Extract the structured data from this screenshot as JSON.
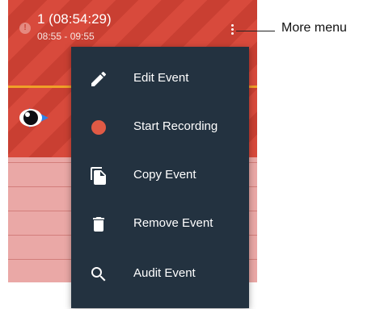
{
  "event": {
    "title": "1 (08:54:29)",
    "time_range": "08:55 - 09:55",
    "alert_icon": "alert-circle-icon",
    "more_icon": "kebab-vertical-icon",
    "track_icon": "eye-play-icon"
  },
  "menu": {
    "items": [
      {
        "label": "Edit Event",
        "icon": "pencil-icon"
      },
      {
        "label": "Start Recording",
        "icon": "record-icon"
      },
      {
        "label": "Copy Event",
        "icon": "copy-icon"
      },
      {
        "label": "Remove Event",
        "icon": "trash-icon"
      },
      {
        "label": "Audit Event",
        "icon": "search-icon"
      }
    ]
  },
  "annotation": {
    "label": "More menu"
  },
  "colors": {
    "event_red": "#d84a3c",
    "menu_bg": "#233240",
    "record_red": "#e05a45",
    "accent_orange": "#f0a028"
  }
}
